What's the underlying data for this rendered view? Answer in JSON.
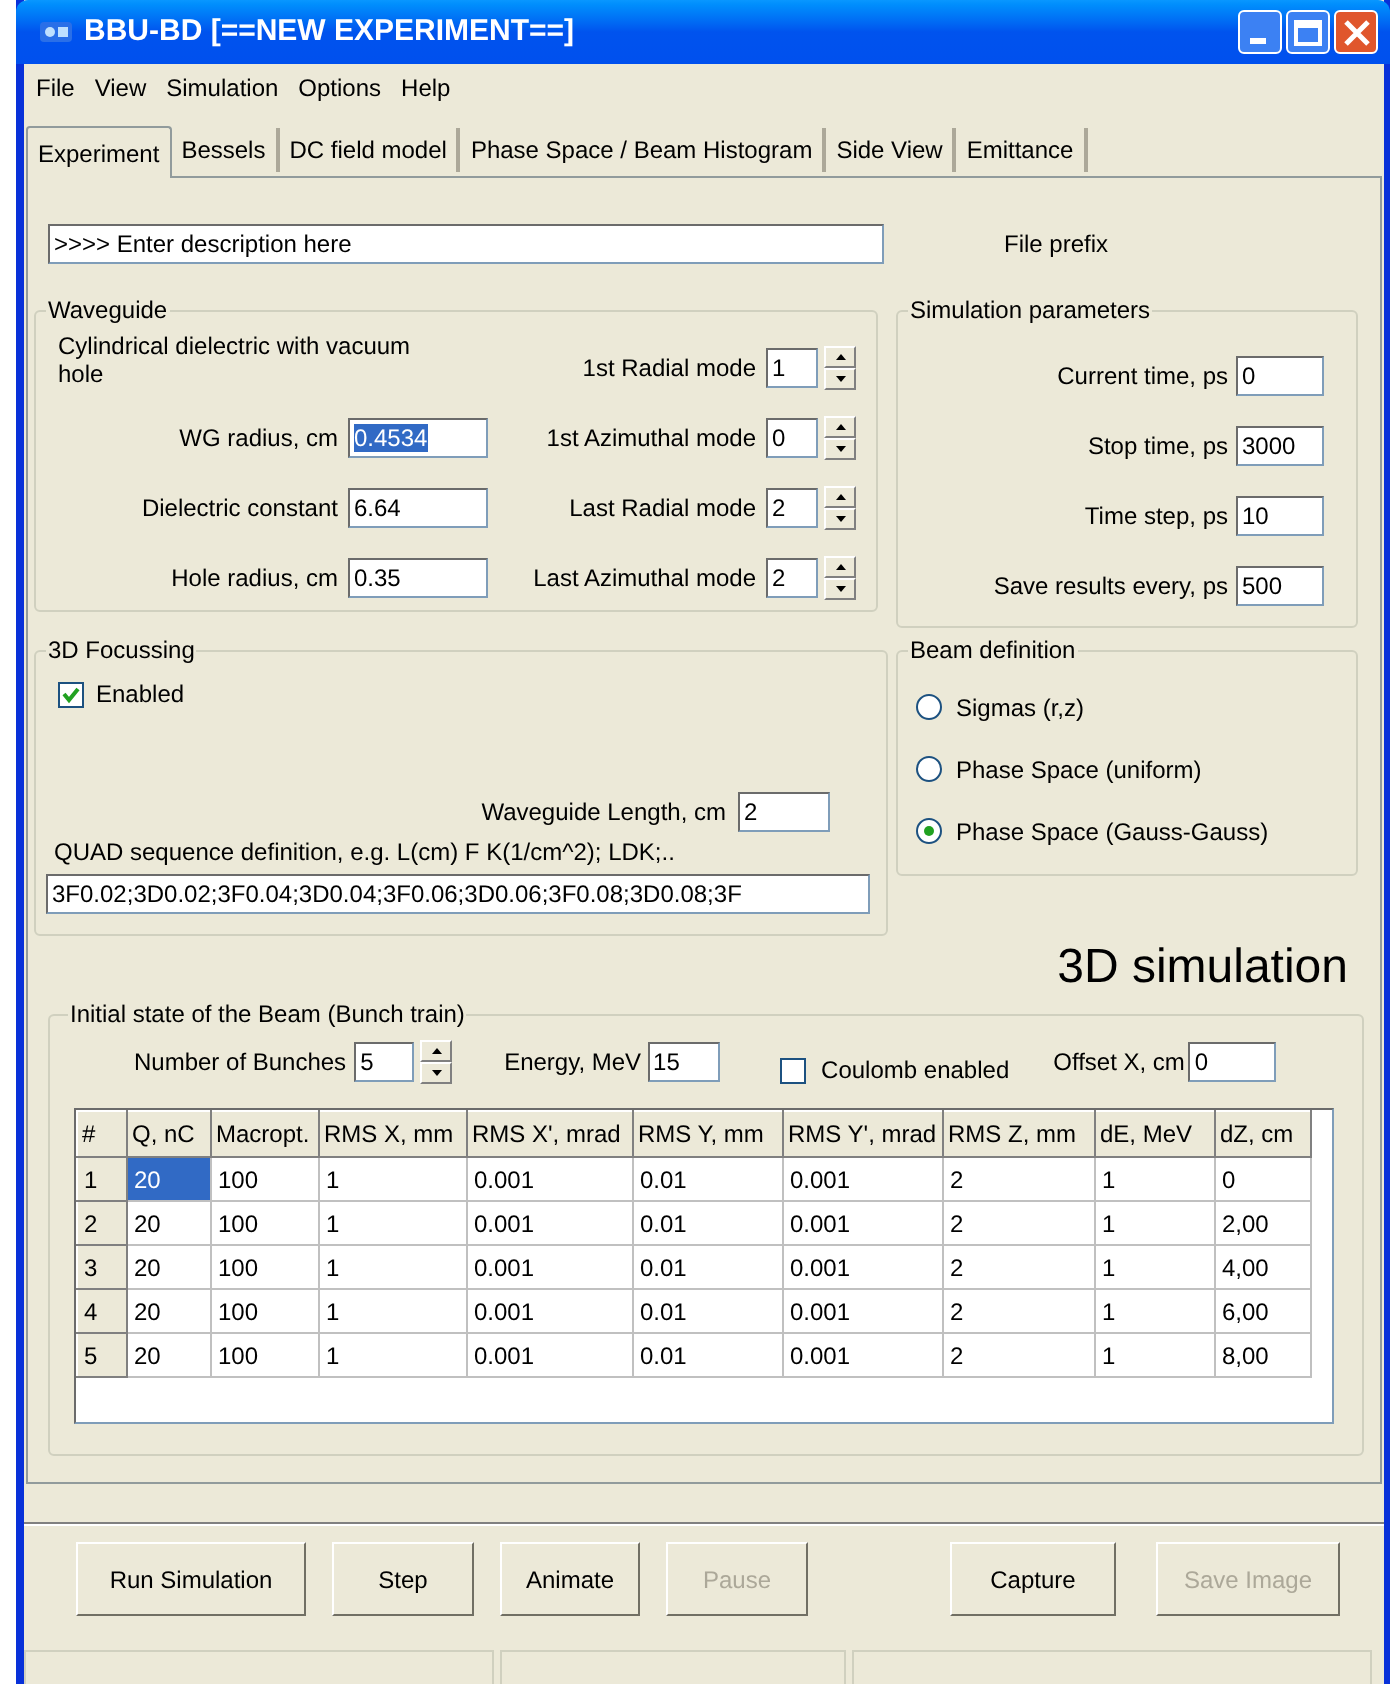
{
  "window": {
    "title": "BBU-BD [==NEW EXPERIMENT==]"
  },
  "menu": [
    "File",
    "View",
    "Simulation",
    "Options",
    "Help"
  ],
  "tabs": [
    {
      "label": "Experiment",
      "selected": true
    },
    {
      "label": "Bessels",
      "selected": false
    },
    {
      "label": "DC field model",
      "selected": false
    },
    {
      "label": "Phase Space / Beam Histogram",
      "selected": false
    },
    {
      "label": "Side View",
      "selected": false
    },
    {
      "label": "Emittance",
      "selected": false
    }
  ],
  "description": {
    "value": ">>>> Enter description here",
    "label": "File prefix"
  },
  "waveguide": {
    "title": "Waveguide",
    "note": "Cylindrical dielectric with vacuum hole",
    "fields": [
      {
        "label": "WG radius, cm",
        "value": "0.4534",
        "text_selected": true
      },
      {
        "label": "Dielectric constant",
        "value": "6.64",
        "text_selected": false
      },
      {
        "label": "Hole radius, cm",
        "value": "0.35",
        "text_selected": false
      }
    ],
    "modes": [
      {
        "label": "1st Radial mode",
        "value": "1"
      },
      {
        "label": "1st Azimuthal mode",
        "value": "0"
      },
      {
        "label": "Last Radial mode",
        "value": "2"
      },
      {
        "label": "Last Azimuthal mode",
        "value": "2"
      }
    ]
  },
  "simulation_parameters": {
    "title": "Simulation parameters",
    "fields": [
      {
        "label": "Current time, ps",
        "value": "0"
      },
      {
        "label": "Stop time, ps",
        "value": "3000"
      },
      {
        "label": "Time step, ps",
        "value": "10"
      },
      {
        "label": "Save results every, ps",
        "value": "500"
      }
    ]
  },
  "focussing": {
    "title": "3D Focussing",
    "enabled": {
      "label": "Enabled",
      "checked": true
    },
    "length": {
      "label": "Waveguide Length, cm",
      "value": "2"
    },
    "quad_label": "QUAD sequence definition, e.g. L(cm) F K(1/cm^2); LDK;..",
    "quad_value": "3F0.02;3D0.02;3F0.04;3D0.04;3F0.06;3D0.06;3F0.08;3D0.08;3F"
  },
  "beam_definition": {
    "title": "Beam definition",
    "options": [
      {
        "label": "Sigmas (r,z)",
        "selected": false
      },
      {
        "label": "Phase Space (uniform)",
        "selected": false
      },
      {
        "label": "Phase Space (Gauss-Gauss)",
        "selected": true
      }
    ]
  },
  "heading": "3D simulation",
  "beam": {
    "title": "Initial state of the Beam (Bunch train)",
    "bunches": {
      "label": "Number of Bunches",
      "value": "5"
    },
    "energy": {
      "label": "Energy, MeV",
      "value": "15"
    },
    "coulomb": {
      "label": "Coulomb enabled",
      "checked": false
    },
    "offset": {
      "label": "Offset X, cm",
      "value": "0"
    }
  },
  "table": {
    "columns": [
      "#",
      "Q, nC",
      "Macropt.",
      "RMS X, mm",
      "RMS X', mrad",
      "RMS Y, mm",
      "RMS Y', mrad",
      "RMS Z, mm",
      "dE, MeV",
      "dZ, cm"
    ],
    "rows": [
      {
        "selected": true,
        "cells": [
          "1",
          "20",
          "100",
          "1",
          "0.001",
          "0.01",
          "0.001",
          "2",
          "1",
          "0"
        ]
      },
      {
        "selected": false,
        "cells": [
          "2",
          "20",
          "100",
          "1",
          "0.001",
          "0.01",
          "0.001",
          "2",
          "1",
          "2,00"
        ]
      },
      {
        "selected": false,
        "cells": [
          "3",
          "20",
          "100",
          "1",
          "0.001",
          "0.01",
          "0.001",
          "2",
          "1",
          "4,00"
        ]
      },
      {
        "selected": false,
        "cells": [
          "4",
          "20",
          "100",
          "1",
          "0.001",
          "0.01",
          "0.001",
          "2",
          "1",
          "6,00"
        ]
      },
      {
        "selected": false,
        "cells": [
          "5",
          "20",
          "100",
          "1",
          "0.001",
          "0.01",
          "0.001",
          "2",
          "1",
          "8,00"
        ]
      }
    ]
  },
  "buttons": [
    {
      "label": "Run Simulation",
      "disabled": false
    },
    {
      "label": "Step",
      "disabled": false
    },
    {
      "label": "Animate",
      "disabled": false
    },
    {
      "label": "Pause",
      "disabled": true
    },
    {
      "label": "Capture",
      "disabled": false
    },
    {
      "label": "Save Image",
      "disabled": true
    }
  ]
}
